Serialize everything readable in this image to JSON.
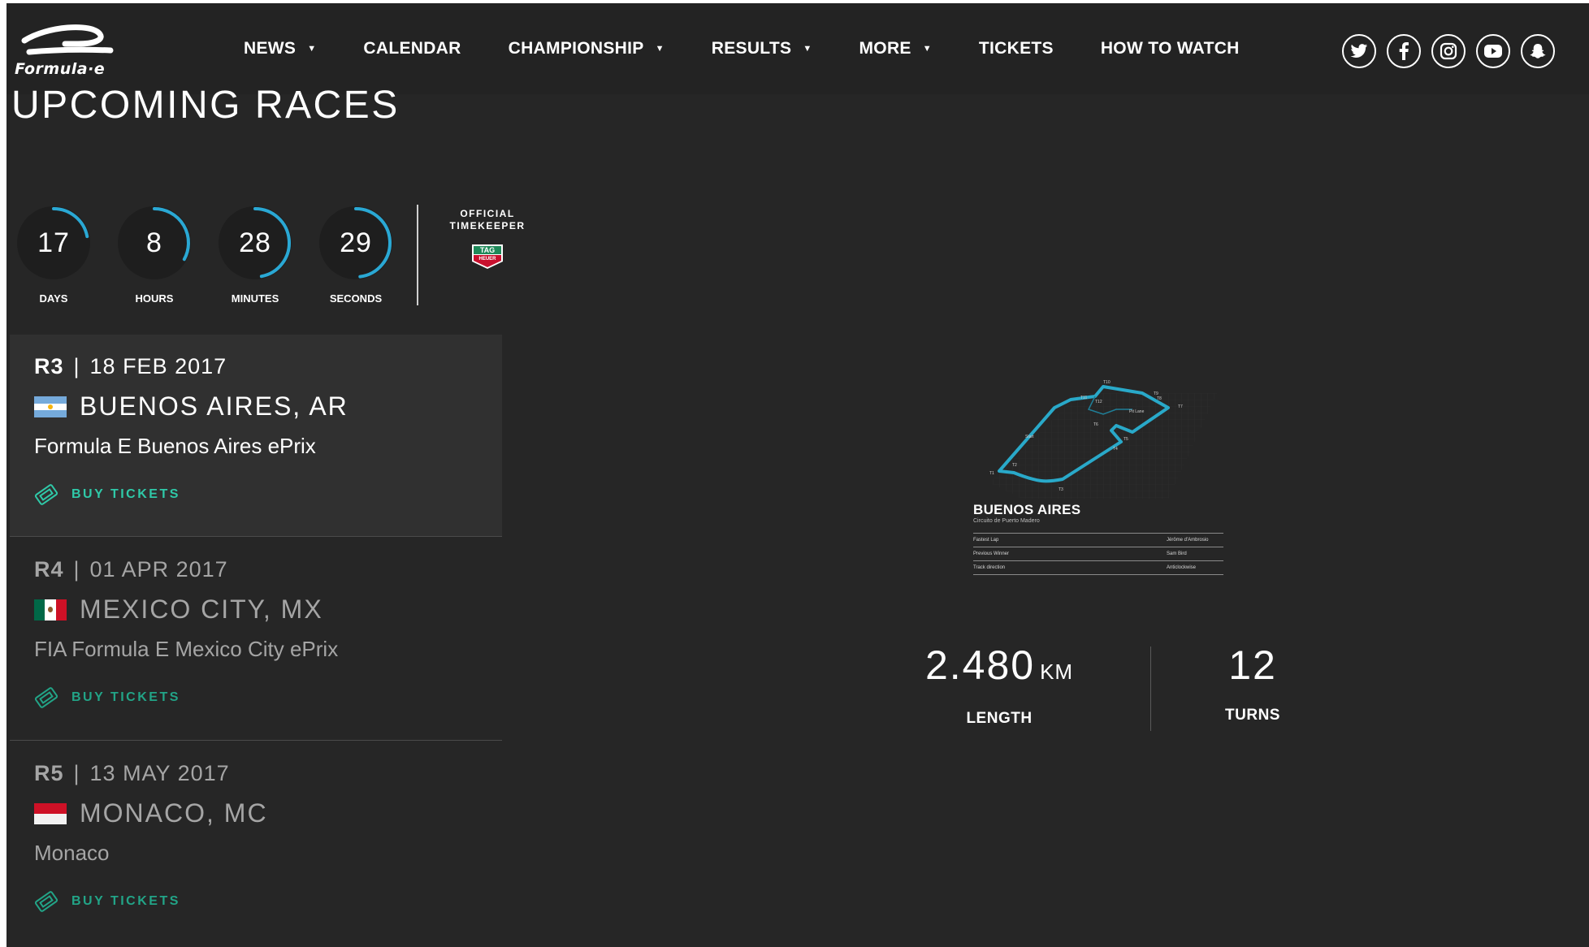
{
  "brand": {
    "logo_text": "Formula·e"
  },
  "nav": {
    "items": [
      {
        "label": "NEWS",
        "dropdown": true
      },
      {
        "label": "CALENDAR",
        "dropdown": false
      },
      {
        "label": "CHAMPIONSHIP",
        "dropdown": true
      },
      {
        "label": "RESULTS",
        "dropdown": true
      },
      {
        "label": "MORE",
        "dropdown": true
      },
      {
        "label": "TICKETS",
        "dropdown": false
      },
      {
        "label": "HOW TO WATCH",
        "dropdown": false
      }
    ],
    "social_icons": [
      "twitter-icon",
      "facebook-icon",
      "instagram-icon",
      "youtube-icon",
      "snapchat-icon"
    ]
  },
  "page": {
    "title": "UPCOMING RACES"
  },
  "countdown": {
    "units": [
      {
        "value": "17",
        "label": "DAYS",
        "progress": 0.22
      },
      {
        "value": "8",
        "label": "HOURS",
        "progress": 0.33
      },
      {
        "value": "28",
        "label": "MINUTES",
        "progress": 0.47
      },
      {
        "value": "29",
        "label": "SECONDS",
        "progress": 0.48
      }
    ],
    "timekeeper_line1": "OFFICIAL",
    "timekeeper_line2": "TIMEKEEPER",
    "timekeeper_brand_line1": "TAG",
    "timekeeper_brand_line2": "HEUER"
  },
  "races": [
    {
      "round": "R3",
      "date": "18 FEB 2017",
      "city": "BUENOS AIRES, AR",
      "name": "Formula E Buenos Aires ePrix",
      "cta": "BUY TICKETS",
      "flag": "argentina-flag-icon",
      "active": true
    },
    {
      "round": "R4",
      "date": "01 APR 2017",
      "city": "MEXICO CITY, MX",
      "name": "FIA Formula E Mexico City ePrix",
      "cta": "BUY TICKETS",
      "flag": "mexico-flag-icon",
      "active": false
    },
    {
      "round": "R5",
      "date": "13 MAY 2017",
      "city": "MONACO, MC",
      "name": "Monaco",
      "cta": "BUY TICKETS",
      "flag": "monaco-flag-icon",
      "active": false
    }
  ],
  "track": {
    "title": "BUENOS AIRES",
    "subtitle": "Circuito de Puerto Madero",
    "table": [
      {
        "label": "Fastest Lap",
        "value": "Jérôme d'Ambrosio"
      },
      {
        "label": "Previous Winner",
        "value": "Sam Bird"
      },
      {
        "label": "Track direction",
        "value": "Anticlockwise"
      }
    ],
    "map_labels": {
      "start": "Start",
      "pit_lane": "Pit Lane"
    },
    "turn_labels": [
      "T1",
      "T2",
      "T3",
      "T4",
      "T5",
      "T6",
      "T7",
      "T8",
      "T9",
      "T10",
      "T11",
      "T12"
    ],
    "length_value": "2.480",
    "length_unit": "KM",
    "length_label": "LENGTH",
    "turns_value": "12",
    "turns_label": "TURNS"
  },
  "colors": {
    "accent": "#2fc9a8",
    "track_line": "#29a9c9",
    "background": "#262626",
    "nav": "#232323"
  }
}
